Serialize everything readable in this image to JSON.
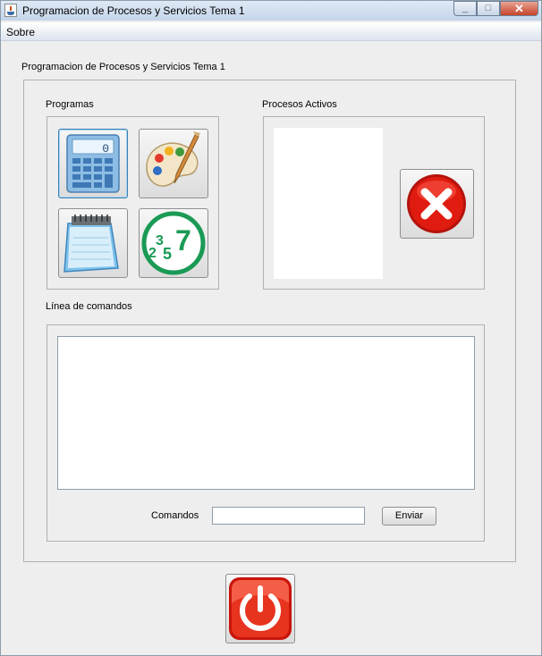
{
  "window": {
    "title": "Programacion de Procesos y Servicios Tema 1",
    "icon": "java-cup-icon",
    "controls": {
      "minimize": "_",
      "maximize": "□",
      "close": "✕"
    }
  },
  "menubar": {
    "items": [
      {
        "label": "Sobre"
      }
    ]
  },
  "frame_title": "Programacion de Procesos y Servicios Tema 1",
  "programs": {
    "label": "Programas",
    "buttons": [
      {
        "icon": "calculator-icon",
        "screen_digit": "0"
      },
      {
        "icon": "paint-palette-icon"
      },
      {
        "icon": "notepad-icon"
      },
      {
        "icon": "prime-numbers-icon",
        "digits": [
          "2",
          "3",
          "5",
          "7"
        ]
      }
    ]
  },
  "processes": {
    "label": "Procesos Activos",
    "kill_icon": "close-red-icon"
  },
  "commands": {
    "label": "Línea de comandos",
    "input_label": "Comandos",
    "input_value": "",
    "send_label": "Enviar"
  },
  "power_icon": "power-icon",
  "colors": {
    "accent_red": "#e01b10",
    "prime_green": "#1a9a55",
    "calc_blue": "#4a8fd0"
  }
}
